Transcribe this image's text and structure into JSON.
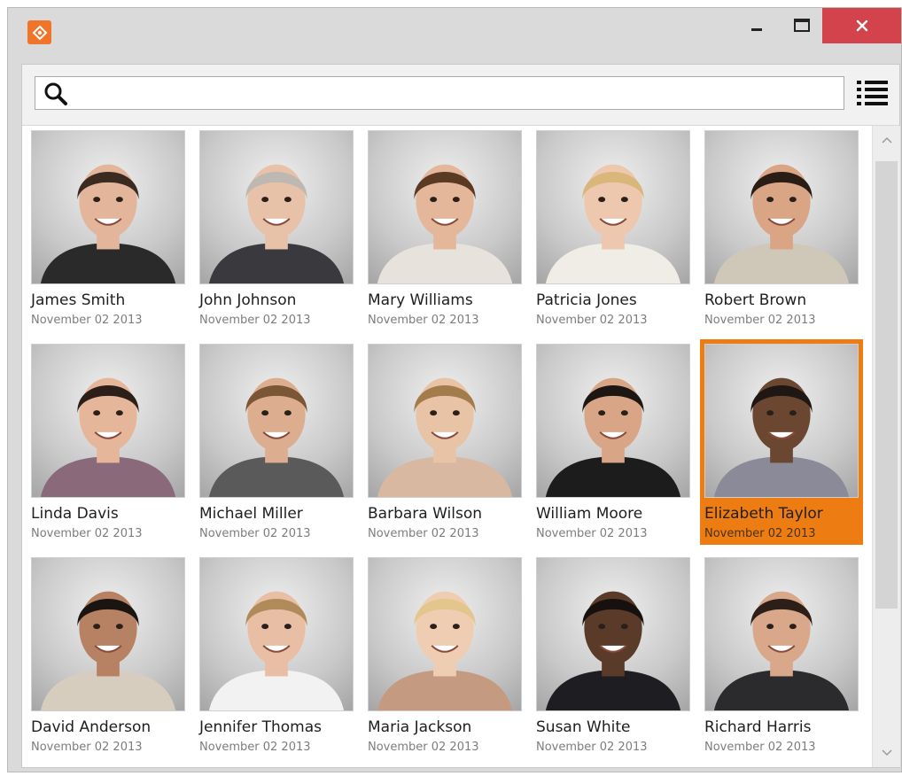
{
  "window": {
    "title_icon": "app-logo-icon",
    "controls": {
      "minimize": "minimize-icon",
      "maximize": "maximize-icon",
      "close": "close-icon"
    },
    "colors": {
      "app_icon": "#f0742a",
      "close_button": "#d2434b",
      "selection": "#ed7d13"
    }
  },
  "search": {
    "value": "",
    "placeholder": "",
    "icon": "search-icon",
    "view_toggle_icon": "list-view-icon"
  },
  "gallery": {
    "people": [
      {
        "name": "James Smith",
        "date": "November 02 2013"
      },
      {
        "name": "John Johnson",
        "date": "November 02 2013"
      },
      {
        "name": "Mary Williams",
        "date": "November 02 2013"
      },
      {
        "name": "Patricia Jones",
        "date": "November 02 2013"
      },
      {
        "name": "Robert Brown",
        "date": "November 02 2013"
      },
      {
        "name": "Linda Davis",
        "date": "November 02 2013"
      },
      {
        "name": "Michael Miller",
        "date": "November 02 2013"
      },
      {
        "name": "Barbara Wilson",
        "date": "November 02 2013"
      },
      {
        "name": "William Moore",
        "date": "November 02 2013"
      },
      {
        "name": "Elizabeth Taylor",
        "date": "November 02 2013",
        "selected": true
      },
      {
        "name": "David Anderson",
        "date": "November 02 2013"
      },
      {
        "name": "Jennifer Thomas",
        "date": "November 02 2013"
      },
      {
        "name": "Maria Jackson",
        "date": "November 02 2013"
      },
      {
        "name": "Susan White",
        "date": "November 02 2013"
      },
      {
        "name": "Richard Harris",
        "date": "November 02 2013"
      }
    ]
  },
  "scrollbar": {
    "up_icon": "chevron-up-icon",
    "down_icon": "chevron-down-icon"
  }
}
